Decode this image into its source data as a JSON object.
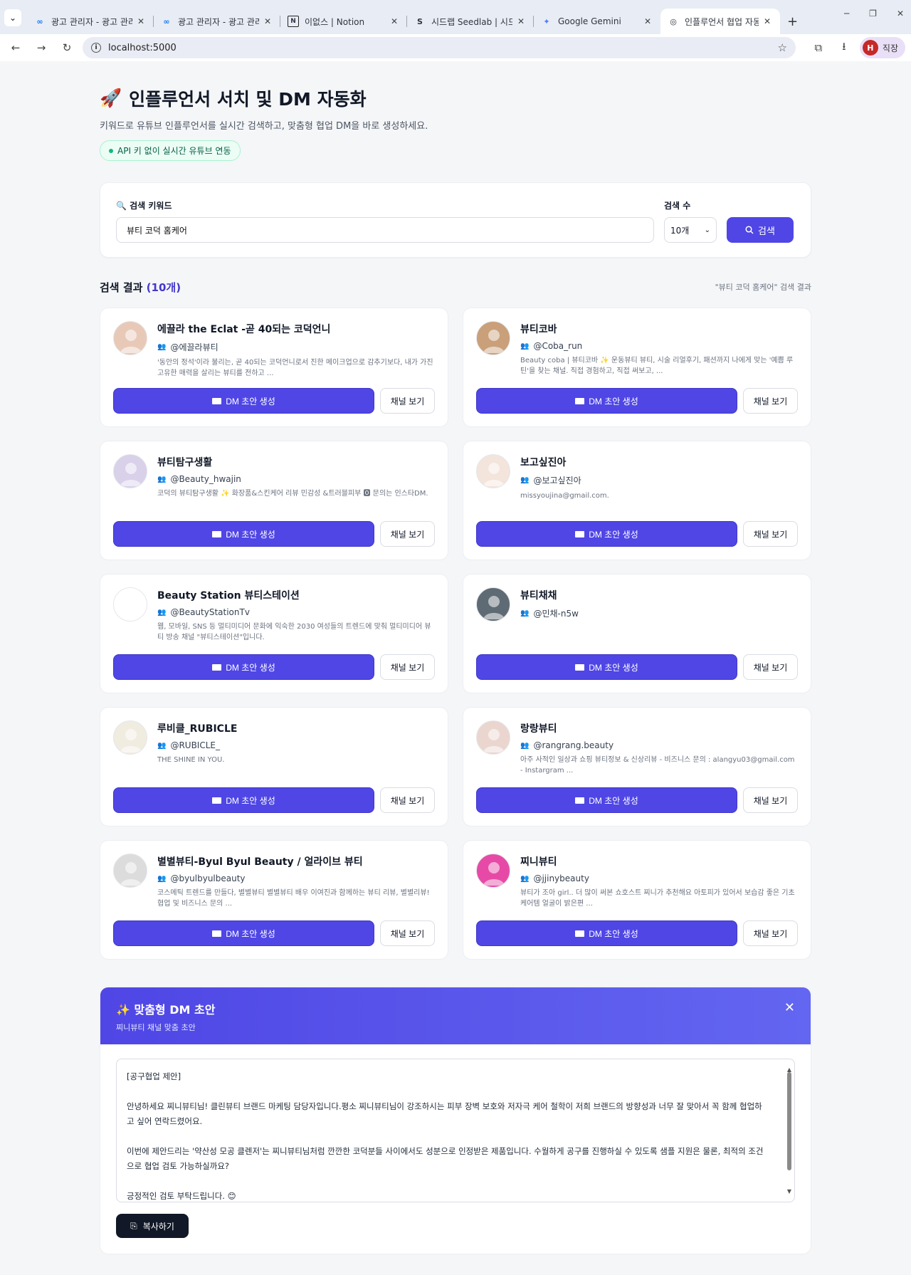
{
  "browser": {
    "tabs": [
      {
        "title": "광고 관리자 - 광고 관리",
        "icon": "meta-icon"
      },
      {
        "title": "광고 관리자 - 광고 관리",
        "icon": "meta-icon"
      },
      {
        "title": "이없스 | Notion",
        "icon": "notion-icon"
      },
      {
        "title": "시드랩 Seedlab | 시드랩",
        "icon": "seedlab-icon"
      },
      {
        "title": "Google Gemini",
        "icon": "gemini-icon"
      },
      {
        "title": "인플루언서 협업 자동화",
        "icon": "globe-icon"
      }
    ],
    "url": "localhost:5000",
    "profile_label": "직장",
    "profile_initial": "H"
  },
  "hero": {
    "emoji": "🚀",
    "title": "인플루언서 서치 및 DM 자동화",
    "subtitle": "키워드로 유튜브 인플루언서를 실시간 검색하고, 맞춤형 협업 DM을 바로 생성하세요.",
    "badge": "API 키 없이 실시간 유튜브 연동"
  },
  "search": {
    "keyword_label": "🔍 검색 키워드",
    "keyword_value": "뷰티 코덕 홈케어",
    "count_label": "검색 수",
    "count_value": "10개",
    "button_label": "검색"
  },
  "results": {
    "title": "검색 결과",
    "count": "(10개)",
    "meta": "\"뷰티 코덕 홈케어\" 검색 결과",
    "dm_button_label": "DM 초안 생성",
    "channel_button_label": "채널 보기",
    "items": [
      {
        "name": "에끌라 the Eclat -곧 40되는 코덕언니",
        "handle": "@에끌라뷰티",
        "desc": "'동안의 정석'이라 불리는, 곧 40되는 코덕언니로서 진한 메이크업으로 감추기보다, 내가 가진 고유한 매력을 살리는 뷰티를 전하고 ...",
        "avatar_color": "#e8c9b8"
      },
      {
        "name": "뷰티코바",
        "handle": "@Coba_run",
        "desc": "Beauty coba | 뷰티코바 ✨ 운동뷰티 뷰티, 시술 리얼후기, 패션까지 나에게 맞는 '예쁨 루틴'을 찾는 채널. 직접 경험하고, 직접 써보고, ...",
        "avatar_color": "#c9a07a"
      },
      {
        "name": "뷰티탐구생활",
        "handle": "@Beauty_hwajin",
        "desc": "코덕의 뷰티탐구생활 ✨ 화장품&스킨케어 리뷰 민감성 &트러블피부 🅾 문의는 인스타DM.",
        "avatar_color": "#d9d0ea"
      },
      {
        "name": "보고싶진아",
        "handle": "@보고싶진아",
        "desc": "missyoujina@gmail.com.",
        "avatar_color": "#f3e4dc"
      },
      {
        "name": "Beauty Station 뷰티스테이션",
        "handle": "@BeautyStationTv",
        "desc": "웹, 모바일, SNS 등 멀티미디어 문화에 익숙한 2030 여성들의 트렌드에 맞춰 멀티미디어 뷰티 방송 채널 \"뷰티스테이션\"입니다.",
        "avatar_color": "#ffffff"
      },
      {
        "name": "뷰티채채",
        "handle": "@민채-n5w",
        "desc": "",
        "avatar_color": "#5f6b74"
      },
      {
        "name": "루비클_RUBICLE",
        "handle": "@RUBICLE_",
        "desc": "THE SHINE IN YOU.",
        "avatar_color": "#f1ece0"
      },
      {
        "name": "랑랑뷰티",
        "handle": "@rangrang.beauty",
        "desc": "아주 사적인 일상과 쇼핑 뷰티정보 & 신상리뷰 - 비즈니스 문의 : alangyu03@gmail.com - Instargram ...",
        "avatar_color": "#ead6cf"
      },
      {
        "name": "별별뷰티-Byul Byul Beauty / 얼라이브 뷰티",
        "handle": "@byulbyulbeauty",
        "desc": "코스메틱 트렌드를 만들다, 별별뷰티 별별뷰티 배우 이여진과 함께하는 뷰티 리뷰, 별별리뷰! 협업 및 비즈니스 문의 ...",
        "avatar_color": "#dcdcdc"
      },
      {
        "name": "찌니뷰티",
        "handle": "@jjinybeauty",
        "desc": "뷰티가 조아 girl.. 더 많이 써본 쇼호스트 찌니가 추천해요 아토피가 있어서 보습감 좋은 기초 케어템 얼굴이 밝은편 ...",
        "avatar_color": "#e74aa6"
      }
    ]
  },
  "dm": {
    "title": "✨ 맞춤형 DM 초안",
    "subtitle": "찌니뷰티 채널 맞춤 초안",
    "paragraphs": [
      "[공구협업 제안]",
      "안녕하세요 찌니뷰티님! 클린뷰티 브랜드 마케팅 담당자입니다.평소 찌니뷰티님이 강조하시는 피부 장벽 보호와 저자극 케어 철학이 저희 브랜드의 방향성과 너무 잘 맞아서 꼭 함께 협업하고 싶어 연락드렸어요.",
      "이번에 제안드리는 '약산성 모공 클렌저'는 찌니뷰티님처럼 깐깐한 코덕분들 사이에서도 성분으로 인정받은 제품입니다. 수월하게 공구를 진행하실 수 있도록 샘플 지원은 물론, 최적의 조건으로 협업 검토 가능하실까요?",
      "긍정적인 검토 부탁드립니다. 😊"
    ],
    "copy_label": "복사하기"
  }
}
